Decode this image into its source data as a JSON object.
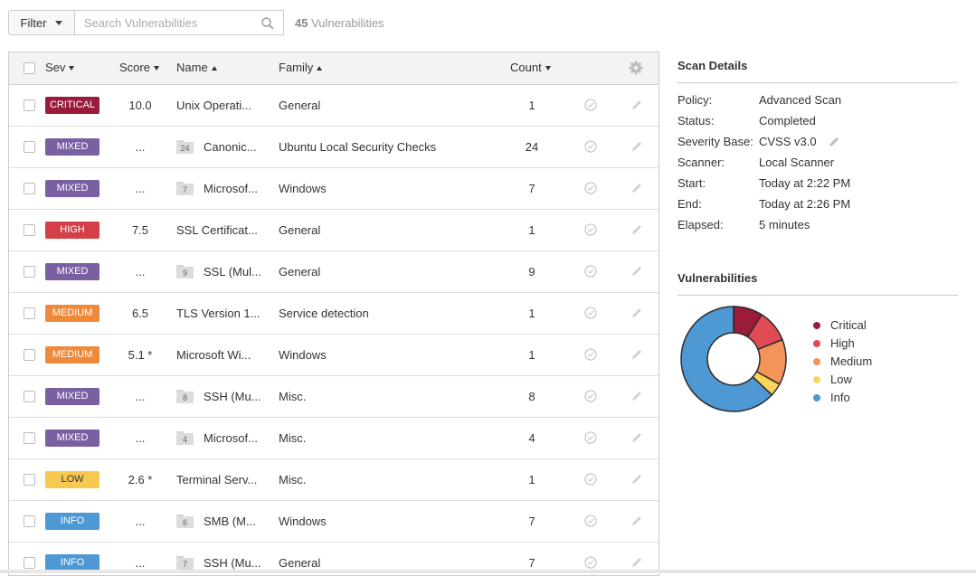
{
  "toolbar": {
    "filter_label": "Filter",
    "search_placeholder": "Search Vulnerabilities",
    "count": "45",
    "count_suffix": "Vulnerabilities"
  },
  "table": {
    "headers": {
      "sev": "Sev",
      "score": "Score",
      "name": "Name",
      "family": "Family",
      "count": "Count"
    },
    "rows": [
      {
        "sev": "CRITICAL",
        "score": "10.0",
        "name": "Unix Operati...",
        "family": "General",
        "count": "1",
        "group": ""
      },
      {
        "sev": "MIXED",
        "score": "...",
        "name": "Canonic...",
        "family": "Ubuntu Local Security Checks",
        "count": "24",
        "group": "24"
      },
      {
        "sev": "MIXED",
        "score": "...",
        "name": "Microsof...",
        "family": "Windows",
        "count": "7",
        "group": "7"
      },
      {
        "sev": "HIGH",
        "score": "7.5",
        "name": "SSL Certificat...",
        "family": "General",
        "count": "1",
        "group": ""
      },
      {
        "sev": "MIXED",
        "score": "...",
        "name": "SSL (Mul...",
        "family": "General",
        "count": "9",
        "group": "9"
      },
      {
        "sev": "MEDIUM",
        "score": "6.5",
        "name": "TLS Version 1...",
        "family": "Service detection",
        "count": "1",
        "group": ""
      },
      {
        "sev": "MEDIUM",
        "score": "5.1 *",
        "name": "Microsoft Wi...",
        "family": "Windows",
        "count": "1",
        "group": ""
      },
      {
        "sev": "MIXED",
        "score": "...",
        "name": "SSH (Mu...",
        "family": "Misc.",
        "count": "8",
        "group": "8"
      },
      {
        "sev": "MIXED",
        "score": "...",
        "name": "Microsof...",
        "family": "Misc.",
        "count": "4",
        "group": "4"
      },
      {
        "sev": "LOW",
        "score": "2.6 *",
        "name": "Terminal Serv...",
        "family": "Misc.",
        "count": "1",
        "group": ""
      },
      {
        "sev": "INFO",
        "score": "...",
        "name": "SMB (M...",
        "family": "Windows",
        "count": "7",
        "group": "6"
      },
      {
        "sev": "INFO",
        "score": "...",
        "name": "SSH (Mu...",
        "family": "General",
        "count": "7",
        "group": "7"
      }
    ]
  },
  "severity_colors": {
    "CRITICAL": "#9b1c3a",
    "MIXED": "#7a5fa3",
    "HIGH": "#d43f48",
    "MEDIUM": "#ee8a3c",
    "LOW": "#f7c950",
    "INFO": "#4e99d3"
  },
  "scan_details": {
    "title": "Scan Details",
    "items": [
      {
        "key": "Policy:",
        "value": "Advanced Scan"
      },
      {
        "key": "Status:",
        "value": "Completed"
      },
      {
        "key": "Severity Base:",
        "value": "CVSS v3.0"
      },
      {
        "key": "Scanner:",
        "value": "Local Scanner"
      },
      {
        "key": "Start:",
        "value": "Today at 2:22 PM"
      },
      {
        "key": "End:",
        "value": "Today at 2:26 PM"
      },
      {
        "key": "Elapsed:",
        "value": "5 minutes"
      }
    ]
  },
  "vulnerabilities": {
    "title": "Vulnerabilities",
    "legend": [
      {
        "label": "Critical",
        "color": "#9b1c3a",
        "share": 0.09
      },
      {
        "label": "High",
        "color": "#e04b55",
        "share": 0.1
      },
      {
        "label": "Medium",
        "color": "#f4935a",
        "share": 0.14
      },
      {
        "label": "Low",
        "color": "#fbd55a",
        "share": 0.04
      },
      {
        "label": "Info",
        "color": "#4e99d3",
        "share": 0.63
      }
    ]
  }
}
